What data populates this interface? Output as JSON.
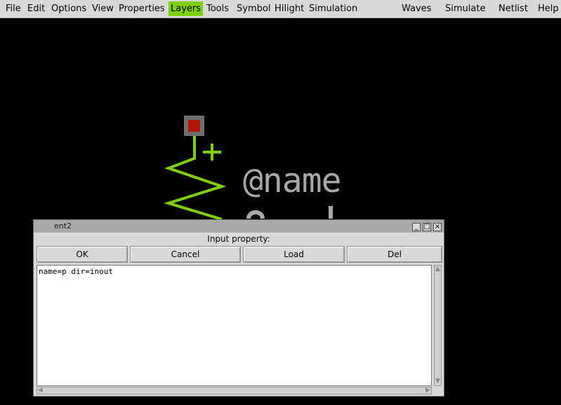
{
  "menu": {
    "items": [
      "File",
      "Edit",
      "Options",
      "View",
      "Properties",
      "Layers",
      "Tools",
      "Symbol",
      "Hilight",
      "Simulation",
      "Waves",
      "Simulate",
      "Netlist",
      "Help"
    ],
    "active": "Layers"
  },
  "canvas": {
    "name_text": "@name",
    "plus_text": "+",
    "colors": {
      "wire": "#7fd000",
      "pin": "#b01800",
      "text": "#a9a9a9",
      "background": "#000000"
    }
  },
  "dialog": {
    "window_title": "ent2",
    "prompt": "Input property:",
    "buttons": {
      "ok": "OK",
      "cancel": "Cancel",
      "load": "Load",
      "del": "Del"
    },
    "text_value": "name=p dir=inout",
    "window_controls": {
      "minimize": "_",
      "maximize": "□",
      "close": "×"
    }
  }
}
